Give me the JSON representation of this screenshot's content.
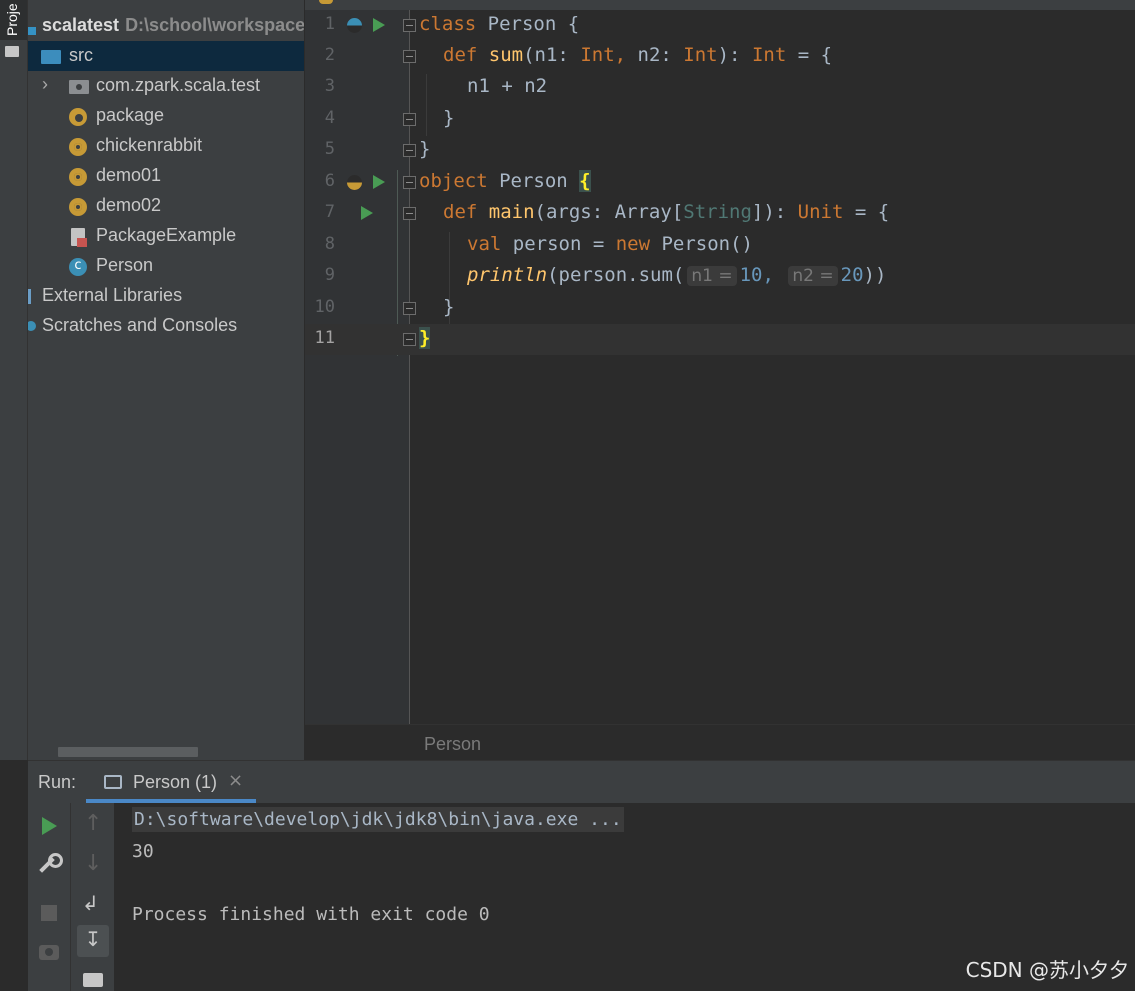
{
  "tool_strip": {
    "project_tab_label": "Proje"
  },
  "project_tree": {
    "root": {
      "name": "scalatest",
      "path": "D:\\school\\workspace"
    },
    "items": [
      {
        "label": "src"
      },
      {
        "label": "com.zpark.scala.test"
      },
      {
        "label": "package"
      },
      {
        "label": "chickenrabbit"
      },
      {
        "label": "demo01"
      },
      {
        "label": "demo02"
      },
      {
        "label": "PackageExample"
      },
      {
        "label": "Person"
      },
      {
        "label": "External Libraries"
      },
      {
        "label": "Scratches and Consoles"
      }
    ]
  },
  "editor": {
    "line_numbers": [
      "1",
      "2",
      "3",
      "4",
      "5",
      "6",
      "7",
      "8",
      "9",
      "10",
      "11"
    ],
    "current_line": 11,
    "code": {
      "l1": {
        "kw": "class",
        "rest": " Person {"
      },
      "l2": {
        "kw1": "def",
        "fn": "sum",
        "p1": "(n1: ",
        "t1": "Int,",
        "p2": " n2: ",
        "t2": "Int",
        "p3": "): ",
        "t3": "Int",
        "p4": " = {"
      },
      "l3": {
        "text": "n1 + n2"
      },
      "l4": {
        "text": "}"
      },
      "l5": {
        "text": "}"
      },
      "l6": {
        "kw": "object",
        "rest": " Person ",
        "brace": "{"
      },
      "l7": {
        "kw1": "def",
        "fn": "main",
        "p1": "(args: Array[",
        "ty": "String",
        "p2": "]): ",
        "t3": "Unit",
        "p4": " = {"
      },
      "l8": {
        "kw1": "val",
        "mid": " person = ",
        "kw2": "new",
        "rest": " Person()"
      },
      "l9": {
        "fn": "println",
        "p1": "(person.sum(",
        "h1": "n1 =",
        "v1": "10,",
        "h2": "n2 =",
        "v2": "20",
        "p2": "))"
      },
      "l10": {
        "text": "}"
      },
      "l11": {
        "brace": "}"
      }
    },
    "breadcrumb": "Person"
  },
  "run_panel": {
    "label": "Run:",
    "tab_label": "Person (1)",
    "tab_close": "×",
    "console": {
      "command": "D:\\software\\develop\\jdk\\jdk8\\bin\\java.exe ...",
      "output": "30",
      "exit": "Process finished with exit code 0"
    }
  },
  "watermark": "CSDN @苏小夕夕",
  "colors": {
    "keyword": "#cc7832",
    "function": "#ffc66d",
    "number": "#6897bb",
    "selection": "#0d293e",
    "run_green": "#499c54"
  }
}
